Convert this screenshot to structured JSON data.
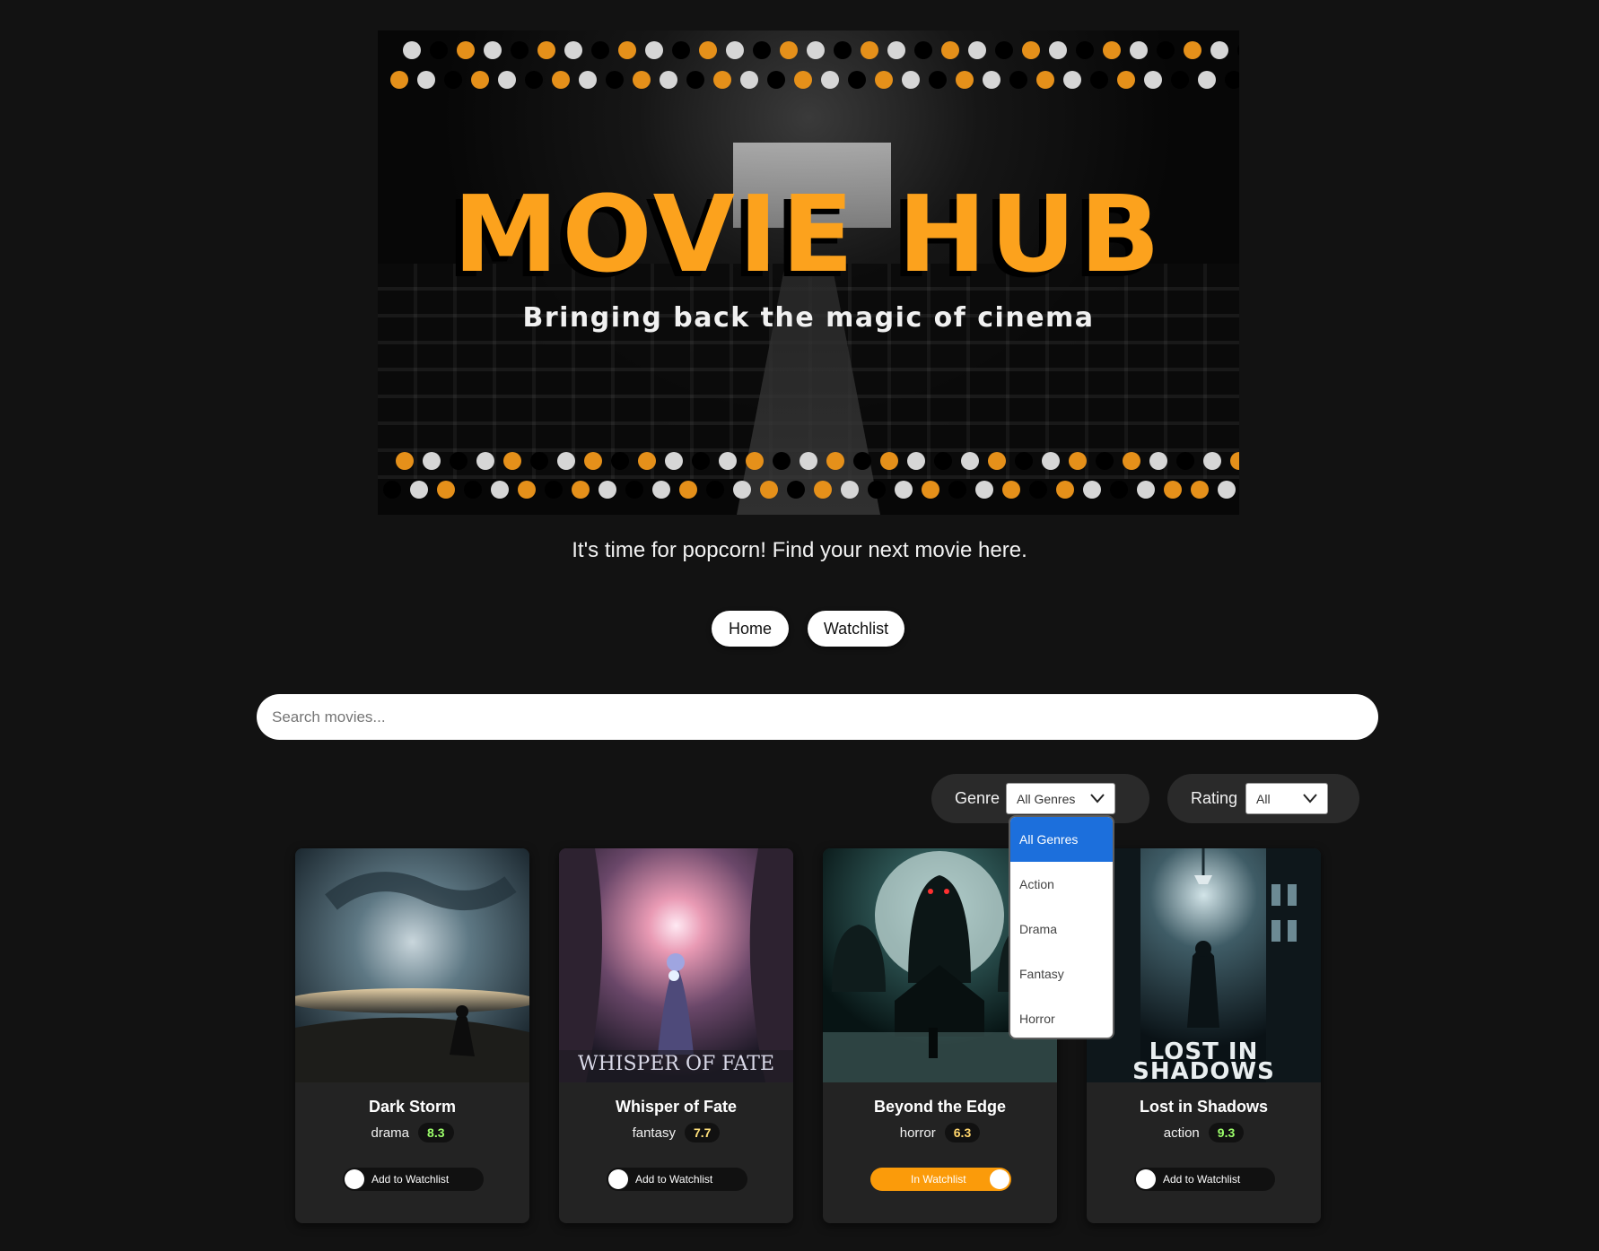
{
  "hero": {
    "title": "MOVIE HUB",
    "subtitle": "Bringing back the magic of cinema",
    "accent": "#fca21d"
  },
  "tagline": "It's time for popcorn! Find your next movie here.",
  "nav": {
    "home_label": "Home",
    "watchlist_label": "Watchlist"
  },
  "search": {
    "placeholder": "Search movies...",
    "value": ""
  },
  "filters": {
    "genre_label": "Genre",
    "genre_selected": "All Genres",
    "genre_options": [
      "All Genres",
      "Action",
      "Drama",
      "Fantasy",
      "Horror"
    ],
    "rating_label": "Rating",
    "rating_selected": "All"
  },
  "movies": [
    {
      "title": "Dark Storm",
      "genre": "drama",
      "rating": "8.3",
      "rating_color": "#9cff6b",
      "watchlist_label": "Add to Watchlist",
      "in_watchlist": false,
      "poster_text": ""
    },
    {
      "title": "Whisper of Fate",
      "genre": "fantasy",
      "rating": "7.7",
      "rating_color": "#ffe07a",
      "watchlist_label": "Add to Watchlist",
      "in_watchlist": false,
      "poster_text": "WHISPER OF FATE"
    },
    {
      "title": "Beyond the Edge",
      "genre": "horror",
      "rating": "6.3",
      "rating_color": "#ffd56b",
      "watchlist_label": "In Watchlist",
      "in_watchlist": true,
      "poster_text": ""
    },
    {
      "title": "Lost in Shadows",
      "genre": "action",
      "rating": "9.3",
      "rating_color": "#9cff6b",
      "watchlist_label": "Add to Watchlist",
      "in_watchlist": false,
      "poster_text": "LOST IN SHADOWS"
    }
  ]
}
